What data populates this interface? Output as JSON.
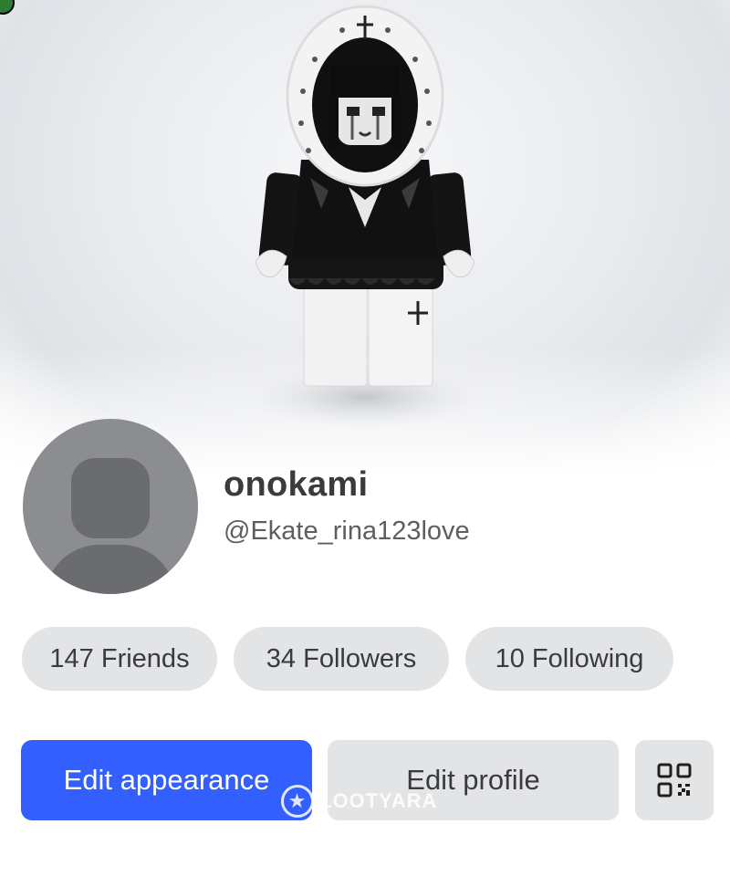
{
  "profile": {
    "display_name": "onokami",
    "username": "@Ekate_rina123love"
  },
  "stats": {
    "friends": "147 Friends",
    "followers": "34 Followers",
    "following": "10 Following"
  },
  "actions": {
    "edit_appearance": "Edit appearance",
    "edit_profile": "Edit profile",
    "qr_icon": "qr-code-icon"
  },
  "watermark": "LOOTYARA",
  "colors": {
    "primary": "#335fff",
    "chip_bg": "#e3e4e6",
    "text_dark": "#393b3d",
    "text_muted": "#5c5e61",
    "avatar_placeholder": "#8c8d90"
  }
}
